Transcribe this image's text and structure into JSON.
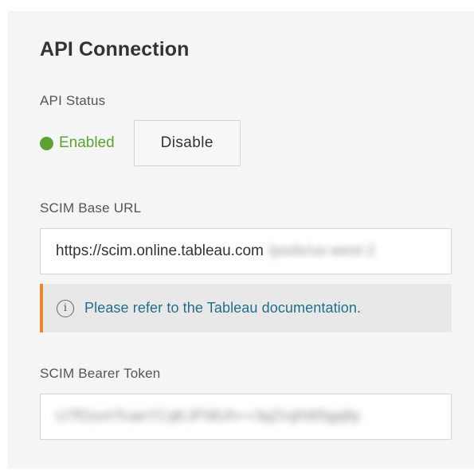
{
  "section": {
    "title": "API Connection"
  },
  "api_status": {
    "label": "API Status",
    "value": "Enabled",
    "indicator_color": "#5aa531",
    "toggle_button_label": "Disable"
  },
  "scim_base_url": {
    "label": "SCIM Base URL",
    "value_visible": "https://scim.online.tableau.com",
    "value_obscured": "/pods/us-west-2"
  },
  "info_banner": {
    "icon": "info-icon",
    "link_text": "Please refer to the Tableau documentation.",
    "accent_color": "#e8862e"
  },
  "scim_bearer_token": {
    "label": "SCIM Bearer Token",
    "value_obscured": "U7fGsvnTcaeYCqKJFNlUh++3qZrxjhW5gq8y"
  }
}
